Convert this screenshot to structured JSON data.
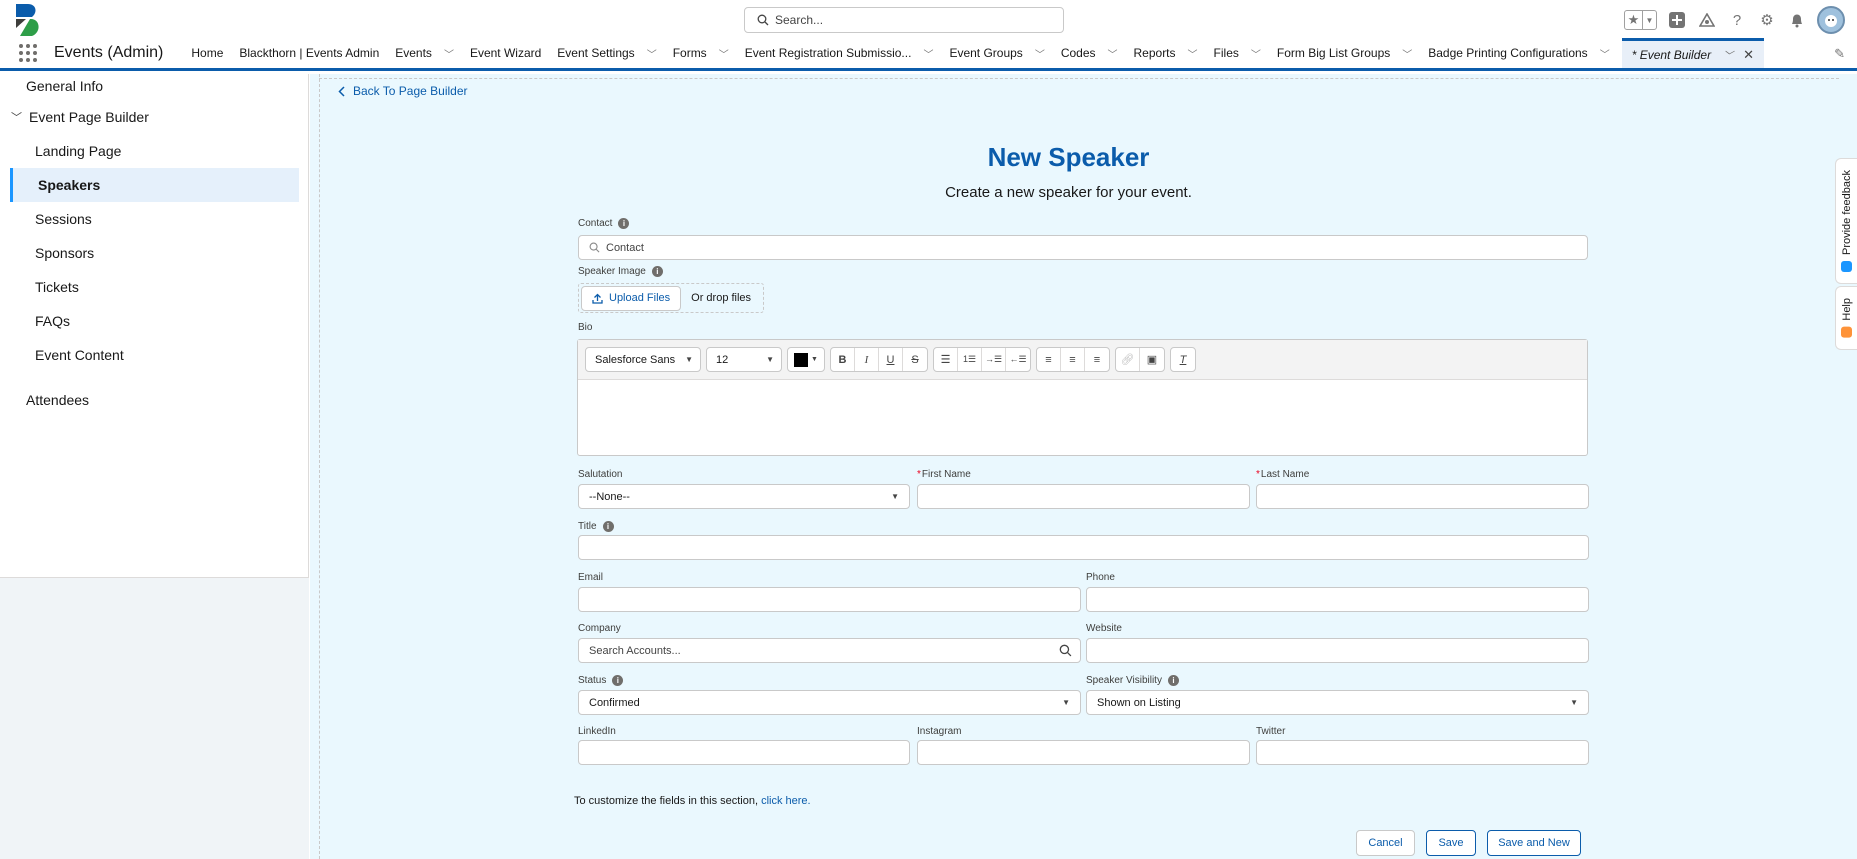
{
  "header": {
    "search_placeholder": "Search...",
    "icons": [
      "favorites-star-icon",
      "favorites-dropdown-icon",
      "global-actions-icon",
      "trailhead-icon",
      "help-icon",
      "setup-gear-icon",
      "notifications-bell-icon",
      "user-avatar"
    ]
  },
  "nav": {
    "app_name": "Events (Admin)",
    "items": [
      {
        "label": "Home",
        "has_menu": false
      },
      {
        "label": "Blackthorn | Events Admin",
        "has_menu": false
      },
      {
        "label": "Events",
        "has_menu": true
      },
      {
        "label": "Event Wizard",
        "has_menu": false
      },
      {
        "label": "Event Settings",
        "has_menu": true
      },
      {
        "label": "Forms",
        "has_menu": true
      },
      {
        "label": "Event Registration Submissio...",
        "has_menu": true
      },
      {
        "label": "Event Groups",
        "has_menu": true
      },
      {
        "label": "Codes",
        "has_menu": true
      },
      {
        "label": "Reports",
        "has_menu": true
      },
      {
        "label": "Files",
        "has_menu": true
      },
      {
        "label": "Form Big List Groups",
        "has_menu": true
      },
      {
        "label": "Badge Printing Configurations",
        "has_menu": true
      }
    ],
    "active_tab": {
      "label": "* Event Builder"
    }
  },
  "sidebar": {
    "general_info": "General Info",
    "event_page_builder": "Event Page Builder",
    "children": [
      "Landing Page",
      "Speakers",
      "Sessions",
      "Sponsors",
      "Tickets",
      "FAQs",
      "Event Content"
    ],
    "active_child": "Speakers",
    "attendees": "Attendees"
  },
  "main": {
    "back_link": "Back To Page Builder",
    "title": "New Speaker",
    "subtitle": "Create a new speaker for your event.",
    "form": {
      "contact": {
        "label": "Contact",
        "placeholder": "Contact"
      },
      "speaker_image": {
        "label": "Speaker Image",
        "upload_label": "Upload Files",
        "drop_text": "Or drop files"
      },
      "bio": {
        "label": "Bio",
        "font_family": "Salesforce Sans",
        "font_size": "12",
        "text_color": "#000000"
      },
      "salutation": {
        "label": "Salutation",
        "value": "--None--"
      },
      "first_name": {
        "label": "First Name",
        "required": true,
        "value": ""
      },
      "last_name": {
        "label": "Last Name",
        "required": true,
        "value": ""
      },
      "title": {
        "label": "Title",
        "value": ""
      },
      "email": {
        "label": "Email",
        "value": ""
      },
      "phone": {
        "label": "Phone",
        "value": ""
      },
      "company": {
        "label": "Company",
        "placeholder": "Search Accounts..."
      },
      "website": {
        "label": "Website",
        "value": ""
      },
      "status": {
        "label": "Status",
        "value": "Confirmed"
      },
      "speaker_visibility": {
        "label": "Speaker Visibility",
        "value": "Shown on Listing"
      },
      "linkedin": {
        "label": "LinkedIn",
        "value": ""
      },
      "instagram": {
        "label": "Instagram",
        "value": ""
      },
      "twitter": {
        "label": "Twitter",
        "value": ""
      }
    },
    "customize_text": "To customize the fields in this section,",
    "customize_link": "click here.",
    "buttons": {
      "cancel": "Cancel",
      "save": "Save",
      "save_and_new": "Save and New"
    }
  },
  "side_tabs": {
    "feedback": "Provide feedback",
    "help": "Help"
  },
  "colors": {
    "brand": "#0b5cab",
    "accent": "#1b96ff",
    "required": "#ea001e",
    "canvas": "#eaf8fe"
  }
}
